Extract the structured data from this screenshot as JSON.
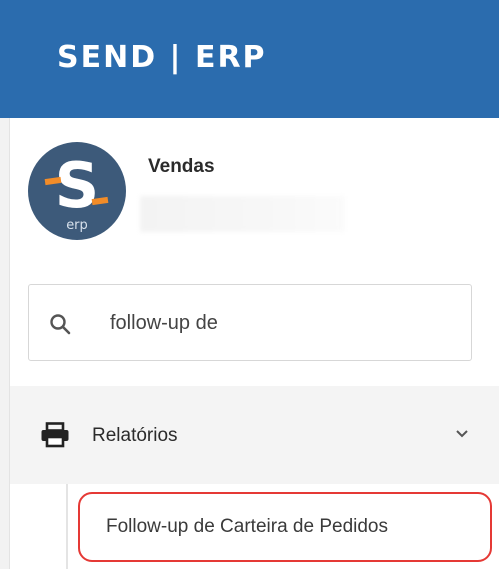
{
  "app": {
    "title": "SEND | ERP"
  },
  "user": {
    "name": "Vendas",
    "logo_text": "erp"
  },
  "search": {
    "value": "follow-up de",
    "icon": "search-icon"
  },
  "menu": {
    "group_label": "Relatórios",
    "group_icon": "printer-icon",
    "expand_icon": "chevron-down-icon",
    "items": [
      {
        "label": "Follow-up de Carteira de Pedidos"
      }
    ]
  },
  "colors": {
    "header": "#2b6cae",
    "logo_background": "#3d5a7a",
    "logo_accent": "#f28c28",
    "highlight": "#e53935"
  }
}
